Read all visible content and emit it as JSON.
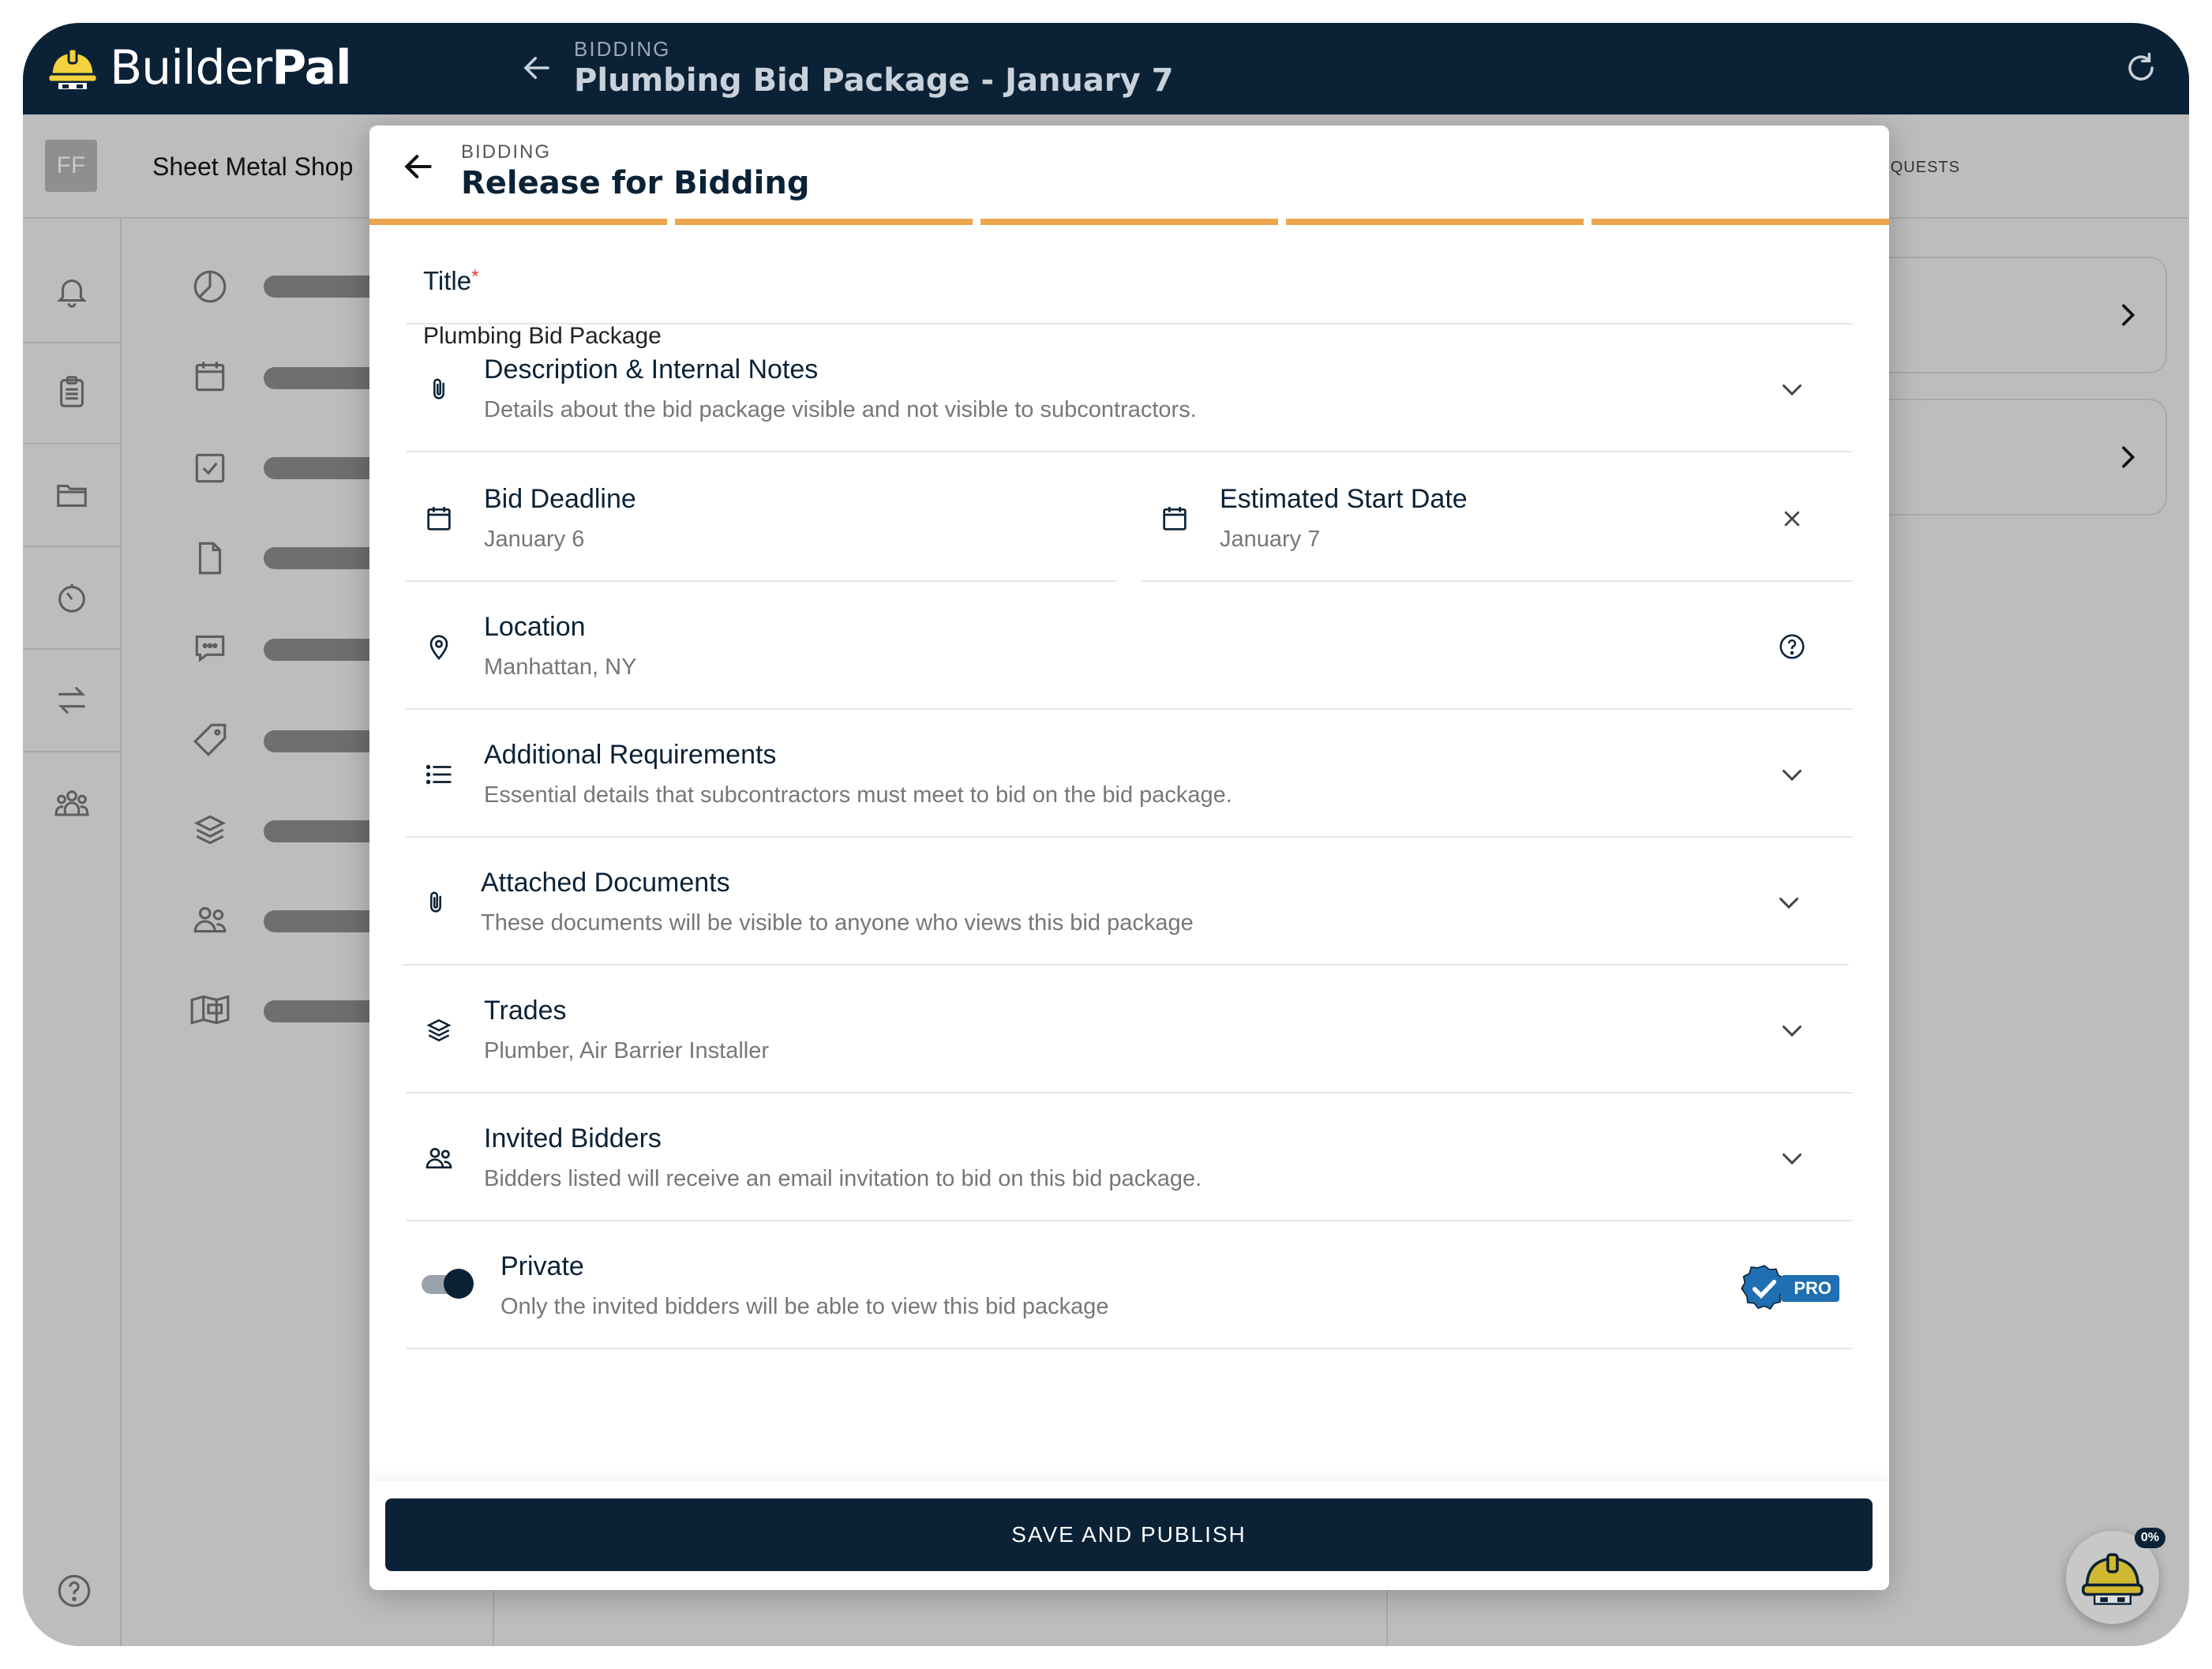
{
  "app": {
    "logo_regular": "Builder",
    "logo_bold": "Pal"
  },
  "header": {
    "section": "BIDDING",
    "title": "Plumbing Bid Package - January 7"
  },
  "subbar": {
    "avatar_initials": "FF",
    "org_name": "Sheet Metal Shop",
    "right_label": "D REQUESTS"
  },
  "modal": {
    "section": "BIDDING",
    "title": "Release for Bidding",
    "progress_steps": 5,
    "title_field": {
      "label": "Title",
      "required_mark": "*",
      "value": "Plumbing Bid Package"
    },
    "rows": {
      "description": {
        "label": "Description & Internal Notes",
        "desc": "Details about the bid package visible and not visible to subcontractors."
      },
      "bid_deadline": {
        "label": "Bid Deadline",
        "value": "January 6"
      },
      "start_date": {
        "label": "Estimated Start Date",
        "value": "January 7"
      },
      "location": {
        "label": "Location",
        "value": "Manhattan, NY"
      },
      "requirements": {
        "label": "Additional Requirements",
        "desc": "Essential details that subcontractors must meet to bid on the bid package."
      },
      "documents": {
        "label": "Attached Documents",
        "desc": "These documents will be visible to anyone who views this bid package"
      },
      "trades": {
        "label": "Trades",
        "value": "Plumber, Air Barrier Installer"
      },
      "bidders": {
        "label": "Invited Bidders",
        "desc": "Bidders listed will receive an email invitation to bid on this bid package."
      },
      "private": {
        "label": "Private",
        "desc": "Only the invited bidders will be able to view this bid package",
        "enabled": true,
        "badge": "PRO"
      }
    },
    "save_button": "SAVE AND PUBLISH"
  },
  "assistant": {
    "badge": "0%"
  },
  "colors": {
    "navy": "#0b2236",
    "accent": "#eba54c",
    "pro_blue": "#1f6fb2",
    "required": "#e53935"
  }
}
